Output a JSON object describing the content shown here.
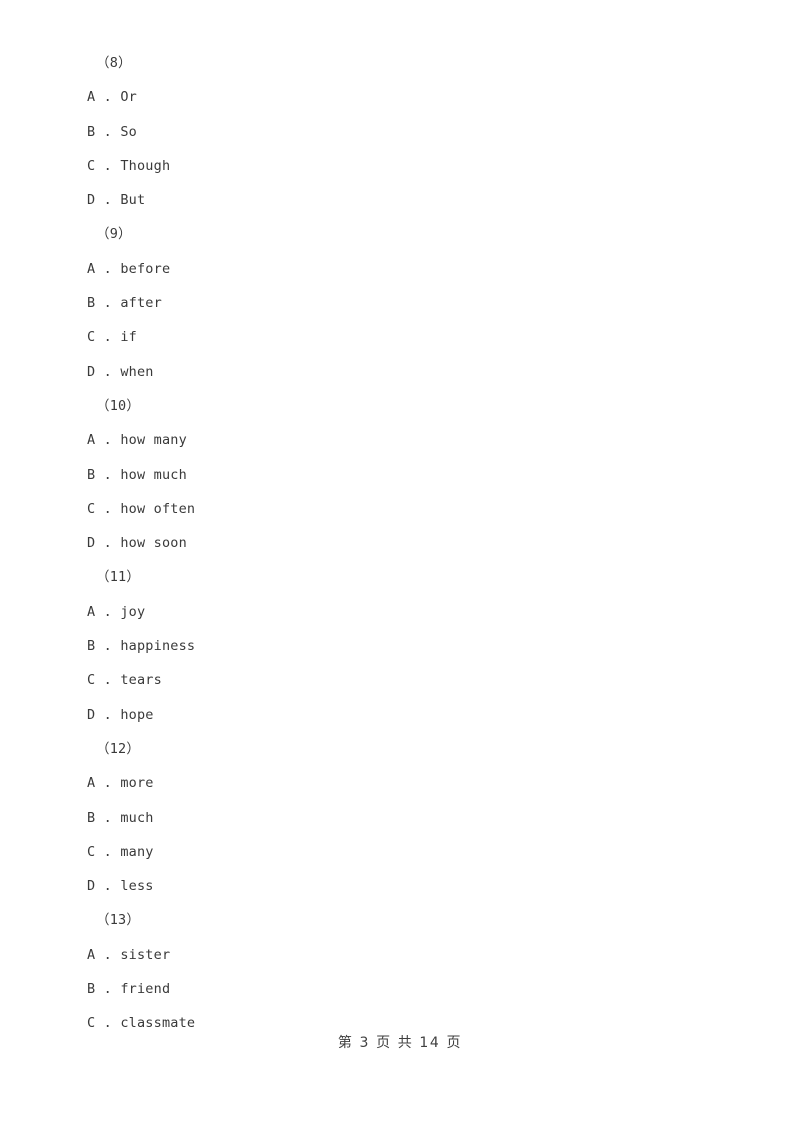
{
  "document": {
    "page_background": "#ffffff",
    "text_color": "#3a3a3a"
  },
  "questions": [
    {
      "number": "（8）",
      "options": [
        {
          "letter": "A",
          "separator": " . ",
          "text": "Or"
        },
        {
          "letter": "B",
          "separator": " . ",
          "text": "So"
        },
        {
          "letter": "C",
          "separator": " . ",
          "text": "Though"
        },
        {
          "letter": "D",
          "separator": " . ",
          "text": "But"
        }
      ]
    },
    {
      "number": "（9）",
      "options": [
        {
          "letter": "A",
          "separator": " . ",
          "text": "before"
        },
        {
          "letter": "B",
          "separator": " . ",
          "text": "after"
        },
        {
          "letter": "C",
          "separator": " . ",
          "text": "if"
        },
        {
          "letter": "D",
          "separator": " . ",
          "text": "when"
        }
      ]
    },
    {
      "number": "（10）",
      "options": [
        {
          "letter": "A",
          "separator": " . ",
          "text": "how many"
        },
        {
          "letter": "B",
          "separator": " . ",
          "text": "how much"
        },
        {
          "letter": "C",
          "separator": " . ",
          "text": "how often"
        },
        {
          "letter": "D",
          "separator": " . ",
          "text": "how soon"
        }
      ]
    },
    {
      "number": "（11）",
      "options": [
        {
          "letter": "A",
          "separator": " . ",
          "text": "joy"
        },
        {
          "letter": "B",
          "separator": " . ",
          "text": "happiness"
        },
        {
          "letter": "C",
          "separator": " . ",
          "text": "tears"
        },
        {
          "letter": "D",
          "separator": " . ",
          "text": "hope"
        }
      ]
    },
    {
      "number": "（12）",
      "options": [
        {
          "letter": "A",
          "separator": " . ",
          "text": "more"
        },
        {
          "letter": "B",
          "separator": " . ",
          "text": "much"
        },
        {
          "letter": "C",
          "separator": " . ",
          "text": "many"
        },
        {
          "letter": "D",
          "separator": " . ",
          "text": "less"
        }
      ]
    },
    {
      "number": "（13）",
      "options": [
        {
          "letter": "A",
          "separator": " . ",
          "text": "sister"
        },
        {
          "letter": "B",
          "separator": " . ",
          "text": "friend"
        },
        {
          "letter": "C",
          "separator": " . ",
          "text": "classmate"
        }
      ]
    }
  ],
  "footer": {
    "text": "第 3 页 共 14 页",
    "current_page": "3",
    "total_pages": "14"
  }
}
